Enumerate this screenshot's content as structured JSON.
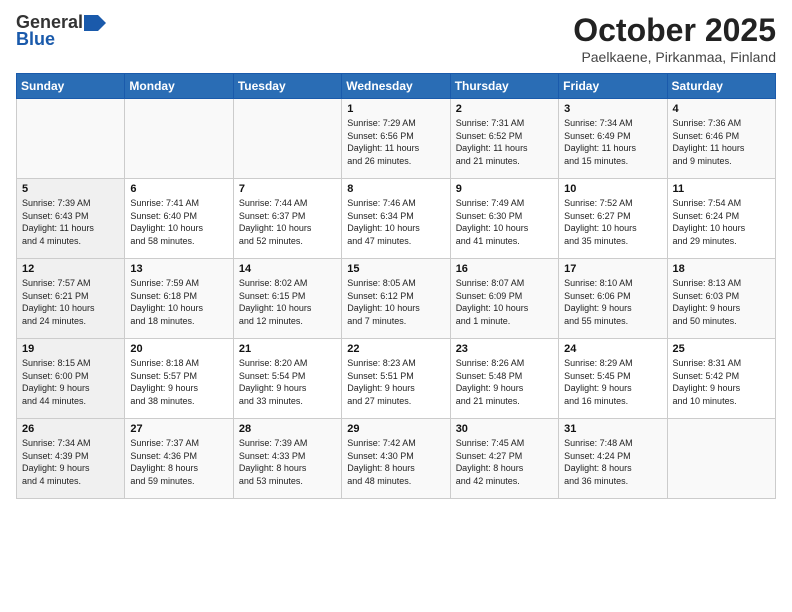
{
  "header": {
    "logo_general": "General",
    "logo_blue": "Blue",
    "month": "October 2025",
    "location": "Paelkaene, Pirkanmaa, Finland"
  },
  "weekdays": [
    "Sunday",
    "Monday",
    "Tuesday",
    "Wednesday",
    "Thursday",
    "Friday",
    "Saturday"
  ],
  "weeks": [
    [
      {
        "day": "",
        "info": ""
      },
      {
        "day": "",
        "info": ""
      },
      {
        "day": "",
        "info": ""
      },
      {
        "day": "1",
        "info": "Sunrise: 7:29 AM\nSunset: 6:56 PM\nDaylight: 11 hours\nand 26 minutes."
      },
      {
        "day": "2",
        "info": "Sunrise: 7:31 AM\nSunset: 6:52 PM\nDaylight: 11 hours\nand 21 minutes."
      },
      {
        "day": "3",
        "info": "Sunrise: 7:34 AM\nSunset: 6:49 PM\nDaylight: 11 hours\nand 15 minutes."
      },
      {
        "day": "4",
        "info": "Sunrise: 7:36 AM\nSunset: 6:46 PM\nDaylight: 11 hours\nand 9 minutes."
      }
    ],
    [
      {
        "day": "5",
        "info": "Sunrise: 7:39 AM\nSunset: 6:43 PM\nDaylight: 11 hours\nand 4 minutes."
      },
      {
        "day": "6",
        "info": "Sunrise: 7:41 AM\nSunset: 6:40 PM\nDaylight: 10 hours\nand 58 minutes."
      },
      {
        "day": "7",
        "info": "Sunrise: 7:44 AM\nSunset: 6:37 PM\nDaylight: 10 hours\nand 52 minutes."
      },
      {
        "day": "8",
        "info": "Sunrise: 7:46 AM\nSunset: 6:34 PM\nDaylight: 10 hours\nand 47 minutes."
      },
      {
        "day": "9",
        "info": "Sunrise: 7:49 AM\nSunset: 6:30 PM\nDaylight: 10 hours\nand 41 minutes."
      },
      {
        "day": "10",
        "info": "Sunrise: 7:52 AM\nSunset: 6:27 PM\nDaylight: 10 hours\nand 35 minutes."
      },
      {
        "day": "11",
        "info": "Sunrise: 7:54 AM\nSunset: 6:24 PM\nDaylight: 10 hours\nand 29 minutes."
      }
    ],
    [
      {
        "day": "12",
        "info": "Sunrise: 7:57 AM\nSunset: 6:21 PM\nDaylight: 10 hours\nand 24 minutes."
      },
      {
        "day": "13",
        "info": "Sunrise: 7:59 AM\nSunset: 6:18 PM\nDaylight: 10 hours\nand 18 minutes."
      },
      {
        "day": "14",
        "info": "Sunrise: 8:02 AM\nSunset: 6:15 PM\nDaylight: 10 hours\nand 12 minutes."
      },
      {
        "day": "15",
        "info": "Sunrise: 8:05 AM\nSunset: 6:12 PM\nDaylight: 10 hours\nand 7 minutes."
      },
      {
        "day": "16",
        "info": "Sunrise: 8:07 AM\nSunset: 6:09 PM\nDaylight: 10 hours\nand 1 minute."
      },
      {
        "day": "17",
        "info": "Sunrise: 8:10 AM\nSunset: 6:06 PM\nDaylight: 9 hours\nand 55 minutes."
      },
      {
        "day": "18",
        "info": "Sunrise: 8:13 AM\nSunset: 6:03 PM\nDaylight: 9 hours\nand 50 minutes."
      }
    ],
    [
      {
        "day": "19",
        "info": "Sunrise: 8:15 AM\nSunset: 6:00 PM\nDaylight: 9 hours\nand 44 minutes."
      },
      {
        "day": "20",
        "info": "Sunrise: 8:18 AM\nSunset: 5:57 PM\nDaylight: 9 hours\nand 38 minutes."
      },
      {
        "day": "21",
        "info": "Sunrise: 8:20 AM\nSunset: 5:54 PM\nDaylight: 9 hours\nand 33 minutes."
      },
      {
        "day": "22",
        "info": "Sunrise: 8:23 AM\nSunset: 5:51 PM\nDaylight: 9 hours\nand 27 minutes."
      },
      {
        "day": "23",
        "info": "Sunrise: 8:26 AM\nSunset: 5:48 PM\nDaylight: 9 hours\nand 21 minutes."
      },
      {
        "day": "24",
        "info": "Sunrise: 8:29 AM\nSunset: 5:45 PM\nDaylight: 9 hours\nand 16 minutes."
      },
      {
        "day": "25",
        "info": "Sunrise: 8:31 AM\nSunset: 5:42 PM\nDaylight: 9 hours\nand 10 minutes."
      }
    ],
    [
      {
        "day": "26",
        "info": "Sunrise: 7:34 AM\nSunset: 4:39 PM\nDaylight: 9 hours\nand 4 minutes."
      },
      {
        "day": "27",
        "info": "Sunrise: 7:37 AM\nSunset: 4:36 PM\nDaylight: 8 hours\nand 59 minutes."
      },
      {
        "day": "28",
        "info": "Sunrise: 7:39 AM\nSunset: 4:33 PM\nDaylight: 8 hours\nand 53 minutes."
      },
      {
        "day": "29",
        "info": "Sunrise: 7:42 AM\nSunset: 4:30 PM\nDaylight: 8 hours\nand 48 minutes."
      },
      {
        "day": "30",
        "info": "Sunrise: 7:45 AM\nSunset: 4:27 PM\nDaylight: 8 hours\nand 42 minutes."
      },
      {
        "day": "31",
        "info": "Sunrise: 7:48 AM\nSunset: 4:24 PM\nDaylight: 8 hours\nand 36 minutes."
      },
      {
        "day": "",
        "info": ""
      }
    ]
  ]
}
